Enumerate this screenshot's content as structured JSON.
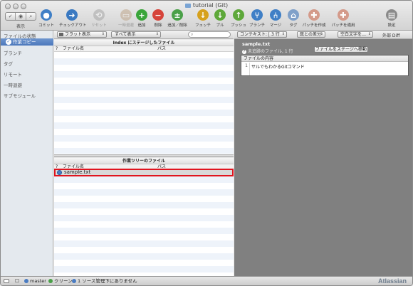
{
  "window": {
    "title": "tutorial (Git)"
  },
  "toolbar": {
    "view_label": "表示",
    "view_options": [
      "✓",
      "◉",
      "⌕"
    ],
    "buttons": [
      {
        "id": "commit",
        "label": "コミット",
        "icon": "commit-icon",
        "color": "#3f7fc6",
        "glyph": "●",
        "disabled": false
      },
      {
        "id": "checkout",
        "label": "チェックアウト",
        "icon": "checkout-icon",
        "color": "#3a79c1",
        "glyph": "➜",
        "disabled": false
      },
      {
        "id": "reset",
        "label": "リセット",
        "icon": "reset-icon",
        "color": "#9a9a9a",
        "glyph": "⟲",
        "disabled": true
      },
      {
        "id": "stash",
        "label": "一時退避",
        "icon": "stash-icon",
        "color": "#b89a7a",
        "glyph": "▭",
        "disabled": true
      },
      {
        "id": "add",
        "label": "追加",
        "icon": "add-icon",
        "color": "#3aa53a",
        "glyph": "+",
        "disabled": false
      },
      {
        "id": "remove",
        "label": "削除",
        "icon": "remove-icon",
        "color": "#d6433a",
        "glyph": "−",
        "disabled": false
      },
      {
        "id": "add-remove",
        "label": "追加／削除",
        "icon": "add-remove-icon",
        "color": "#4aa048",
        "glyph": "±",
        "disabled": false
      },
      {
        "id": "fetch",
        "label": "フェッチ",
        "icon": "fetch-icon",
        "color": "#d6a11d",
        "glyph": "↓",
        "disabled": false
      },
      {
        "id": "pull",
        "label": "プル",
        "icon": "pull-icon",
        "color": "#5ea83a",
        "glyph": "↓",
        "disabled": false
      },
      {
        "id": "push",
        "label": "プッシュ",
        "icon": "push-icon",
        "color": "#5ea83a",
        "glyph": "↑",
        "disabled": false
      },
      {
        "id": "branch",
        "label": "ブランチ",
        "icon": "branch-icon",
        "color": "#3f7fc6",
        "glyph": "⑂",
        "disabled": false
      },
      {
        "id": "merge",
        "label": "マージ",
        "icon": "merge-icon",
        "color": "#3f7fc6",
        "glyph": "⑃",
        "disabled": false
      },
      {
        "id": "tag",
        "label": "タグ",
        "icon": "tag-icon",
        "color": "#7fa0c9",
        "glyph": "⌂",
        "disabled": false
      },
      {
        "id": "create-patch",
        "label": "パッチを作成",
        "icon": "create-patch-icon",
        "color": "#d49a8a",
        "glyph": "✚",
        "disabled": false
      },
      {
        "id": "apply-patch",
        "label": "パッチを適用",
        "icon": "apply-patch-icon",
        "color": "#d49a8a",
        "glyph": "✚",
        "disabled": false
      },
      {
        "id": "settings",
        "label": "設定",
        "icon": "settings-icon",
        "color": "#8a8a8a",
        "glyph": "▤",
        "disabled": false
      }
    ]
  },
  "sidebar": {
    "file_status_header": "ファイルの状態",
    "working_copy": "作業コピー",
    "items": [
      "ブランチ",
      "タグ",
      "リモート",
      "一時退避",
      "サブモジュール"
    ]
  },
  "middle": {
    "filter_dropdown": "フラット表示",
    "show_dropdown": "すべて表示",
    "search_placeholder": "",
    "staged": {
      "title": "Index にステージしたファイル",
      "col_q": "?",
      "col_name": "ファイル名",
      "col_path": "パス"
    },
    "working_tree": {
      "title": "作業ツリーのファイル",
      "col_q": "?",
      "col_name": "ファイル名",
      "col_path": "パス",
      "files": [
        "sample.txt"
      ]
    }
  },
  "right": {
    "context_label": "コンテキスト:",
    "context_value": "3 行",
    "diff_mode": "既との差分",
    "whitespace": "空白文字を…",
    "external_diff": "外部 Diff",
    "file_name": "sample.txt",
    "file_info": "未追跡のファイル, 1 行",
    "stage_button": "ファイルをステージへ移動",
    "content_header": "ファイルの内容",
    "lines": [
      {
        "num": "1",
        "text": "サルでもわかるGitコマンド"
      }
    ]
  },
  "status": {
    "branch": "master",
    "clean": "クリーン",
    "untracked": "1 ソース管理下にありません",
    "brand": "Atlassian"
  }
}
